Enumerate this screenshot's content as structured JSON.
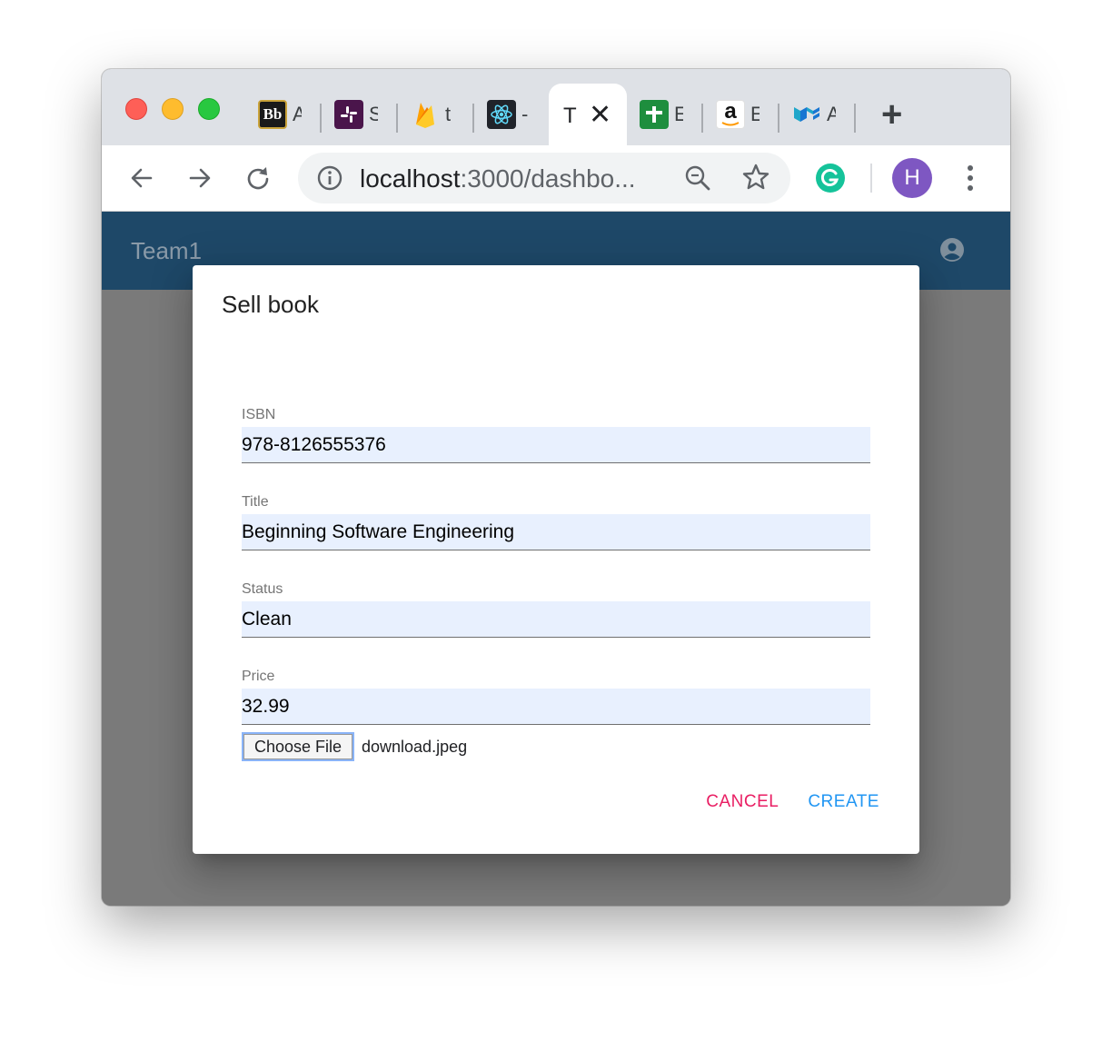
{
  "browser": {
    "tabs": [
      {
        "icon": "blackboard-icon",
        "label": "A",
        "badge": "Bb"
      },
      {
        "icon": "slack-icon",
        "label": "S"
      },
      {
        "icon": "firebase-icon",
        "label": "t"
      },
      {
        "icon": "react-icon",
        "label": "-"
      },
      {
        "icon": "sheets-icon",
        "label": "E"
      },
      {
        "icon": "amazon-icon",
        "label": "E",
        "badge": "a"
      },
      {
        "icon": "material-ui-icon",
        "label": "A"
      }
    ],
    "active_tab": {
      "label": "T"
    },
    "new_tab_label": "+",
    "url_host": "localhost",
    "url_path": ":3000/dashbo...",
    "profile_initial": "H"
  },
  "app": {
    "brand": "Team1"
  },
  "dialog": {
    "title": "Sell book",
    "fields": [
      {
        "label": "ISBN",
        "value": "978-8126555376"
      },
      {
        "label": "Title",
        "value": "Beginning Software Engineering"
      },
      {
        "label": "Status",
        "value": "Clean"
      },
      {
        "label": "Price",
        "value": "32.99"
      }
    ],
    "file_button": "Choose File",
    "file_name": "download.jpeg",
    "cancel_label": "CANCEL",
    "create_label": "CREATE"
  },
  "colors": {
    "appbar": "#1e4868",
    "cancel": "#e91e63",
    "create": "#2196f3",
    "avatar": "#7e57c2"
  }
}
